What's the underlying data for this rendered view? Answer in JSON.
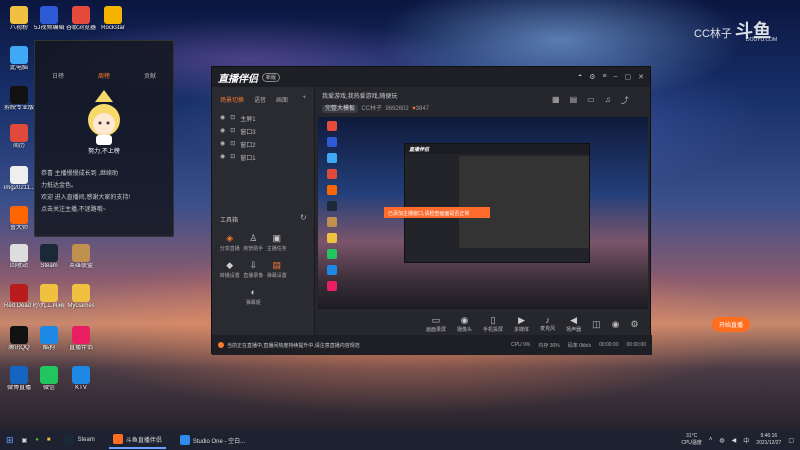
{
  "desktop": {
    "icons": [
      {
        "label": "八视粉",
        "color": "#f0c040"
      },
      {
        "label": "5J视频编辑",
        "color": "#2d5bd6"
      },
      {
        "label": "谷歌浏览器",
        "color": "#e64a3b"
      },
      {
        "label": "Rockstar",
        "color": "#f5b400"
      },
      {
        "label": "此电脑",
        "color": "#3fa9f5"
      },
      {
        "label": "剪映专业版",
        "color": "#111111"
      },
      {
        "label": "简历",
        "color": "#e04a3a"
      },
      {
        "label": "img20211...",
        "color": "#eeeeee"
      },
      {
        "label": "鲁大师",
        "color": "#ff6600"
      },
      {
        "label": "回收站",
        "color": "#dddddd"
      },
      {
        "label": "Steam",
        "color": "#1b2838"
      },
      {
        "label": "英雄联盟",
        "color": "#c09050"
      },
      {
        "label": "Red Dead Redempti...",
        "color": "#b91c1c"
      },
      {
        "label": "小丸工具箱",
        "color": "#f0c040"
      },
      {
        "label": "MyGames",
        "color": "#f0c040"
      },
      {
        "label": "腾讯QQ",
        "color": "#111111"
      },
      {
        "label": "酷狗",
        "color": "#1e88e5"
      },
      {
        "label": "直播伴侣",
        "color": "#e91e63"
      },
      {
        "label": "微博直播",
        "color": "#1565c0"
      },
      {
        "label": "微信",
        "color": "#22c55e"
      },
      {
        "label": "KTV",
        "color": "#1e88e5"
      }
    ]
  },
  "logo": {
    "text": "CC林子",
    "big": "斗鱼",
    "sub": "DOUYU.COM"
  },
  "chat": {
    "tabs": [
      "日榜",
      "周榜",
      "贡献"
    ],
    "art_text": "努力,不上榜",
    "messages": [
      "恭喜 主播慢慢成长到 ,继续助",
      "力抵达金色。",
      "欢迎 进入直播间,感谢大家的支持!",
      "点击关注主播,不迷路哦~"
    ]
  },
  "app": {
    "brand": "直播伴侣",
    "version": "新版",
    "source_tabs": [
      "场景切换",
      "语音",
      "画面"
    ],
    "sources": [
      "主屏1",
      "窗口3",
      "窗口2",
      "窗口1"
    ],
    "tools_title": "工具箱",
    "tools": [
      {
        "label": "分享直播",
        "orange": true,
        "icon": "◈"
      },
      {
        "label": "房管助手",
        "orange": false,
        "icon": "♙"
      },
      {
        "label": "主播任务",
        "orange": false,
        "icon": "▣"
      },
      {
        "label": "",
        "orange": false,
        "icon": ""
      },
      {
        "label": "转播设置",
        "orange": false,
        "icon": "◆"
      },
      {
        "label": "直播录像",
        "orange": false,
        "icon": "⇩"
      },
      {
        "label": "弹幕设置",
        "orange": true,
        "icon": "▤"
      },
      {
        "label": "",
        "orange": false,
        "icon": ""
      },
      {
        "label": "",
        "orange": false,
        "icon": ""
      },
      {
        "label": "弹幕姬",
        "orange": false,
        "icon": "◐"
      },
      {
        "label": "",
        "orange": false,
        "icon": ""
      },
      {
        "label": "",
        "orange": false,
        "icon": ""
      }
    ],
    "stream_title": "我爱游戏,我热爱游戏,随便玩",
    "chip": "完整大模板",
    "room_owner": "CC林子",
    "room_id": "9692602",
    "followers": "3847",
    "bottom_buttons": [
      {
        "label": "画面录屏",
        "icon": "▭"
      },
      {
        "label": "摄像头",
        "icon": "◉"
      },
      {
        "label": "手机投屏",
        "icon": "▯"
      },
      {
        "label": "多媒体",
        "icon": "▶"
      },
      {
        "label": "麦克风",
        "icon": "♪"
      },
      {
        "label": "扬声器",
        "icon": "◀"
      }
    ],
    "golive": "开始直播",
    "toast": "已添加主播窗口,请检查画面是否正常",
    "status_tip": "当前正在直播中,直播间热度持续提升中,请注意直播内容规范",
    "status_metrics": [
      "CPU 9%",
      "内存 30%",
      "码率 0kb/s",
      "00:00:00",
      "00:00:00"
    ]
  },
  "taskbar": {
    "items": [
      {
        "label": "Steam",
        "color": "#1b2838",
        "active": false
      },
      {
        "label": "斗鱼直播伴侣",
        "color": "#ff6d1f",
        "active": true
      },
      {
        "label": "Studio One - 空白...",
        "color": "#2d8cf0",
        "active": false
      }
    ],
    "weather": "31°C",
    "weather_sub": "CPU温度",
    "time": "9:46:16",
    "date": "2021/12/27"
  }
}
